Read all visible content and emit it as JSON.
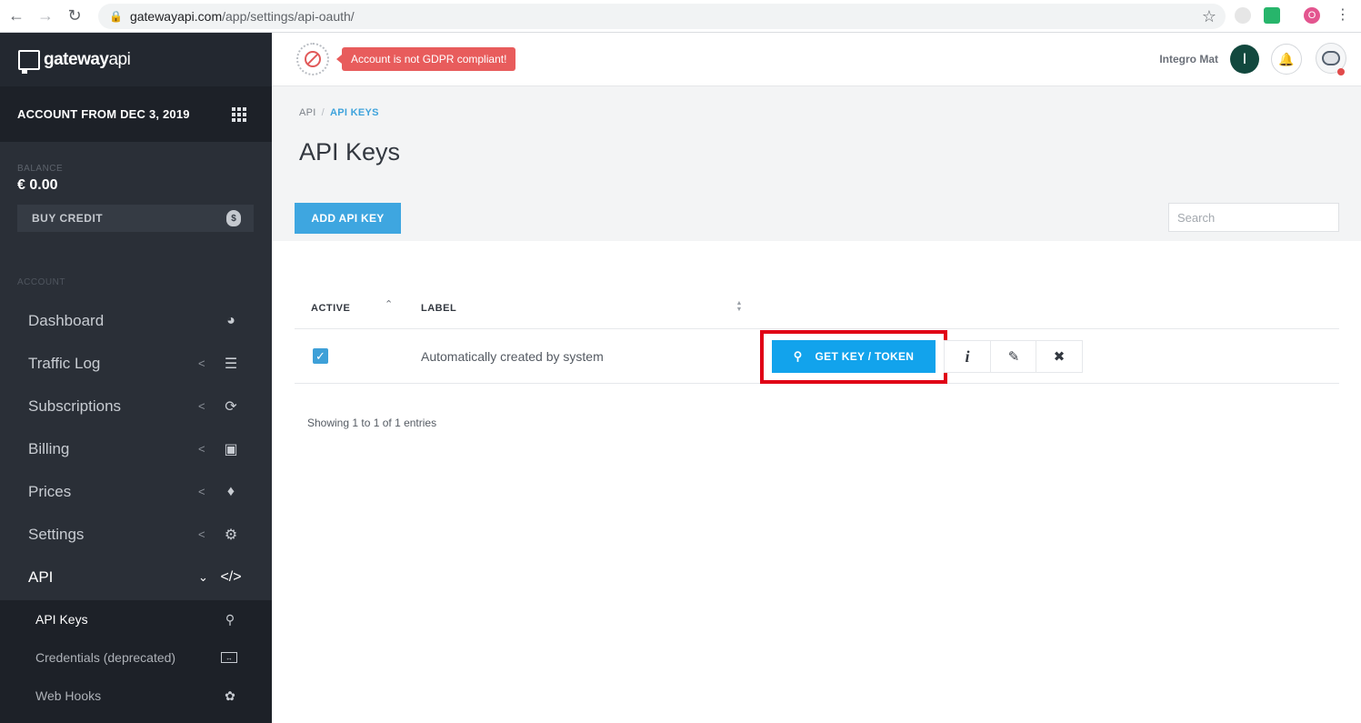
{
  "browser": {
    "url_host": "gatewayapi.com",
    "url_path": "/app/settings/api-oauth/",
    "ext_badge": "O"
  },
  "sidebar": {
    "logo_bold": "gateway",
    "logo_light": "api",
    "account_title": "ACCOUNT FROM DEC 3, 2019",
    "balance_label": "BALANCE",
    "balance_value": "€ 0.00",
    "buy_credit_label": "BUY CREDIT",
    "section_label": "ACCOUNT",
    "items": [
      {
        "label": "Dashboard",
        "icon": "dashboard-icon"
      },
      {
        "label": "Traffic Log",
        "icon": "database-icon"
      },
      {
        "label": "Subscriptions",
        "icon": "refresh-icon"
      },
      {
        "label": "Billing",
        "icon": "wallet-icon"
      },
      {
        "label": "Prices",
        "icon": "tag-icon"
      },
      {
        "label": "Settings",
        "icon": "gear-icon"
      },
      {
        "label": "API",
        "icon": "code-icon"
      }
    ],
    "sub_items": [
      {
        "label": "API Keys",
        "icon": "key-icon"
      },
      {
        "label": "Credentials (deprecated)",
        "icon": "credentials-icon"
      },
      {
        "label": "Web Hooks",
        "icon": "webhook-icon"
      }
    ]
  },
  "header": {
    "gdpr_badge": "Account is not GDPR compliant!",
    "username": "Integro Mat",
    "avatar_letter": "I"
  },
  "main": {
    "breadcrumb_root": "API",
    "breadcrumb_current": "API KEYS",
    "page_title": "API Keys",
    "add_button": "ADD API KEY",
    "search_placeholder": "Search",
    "table": {
      "columns": [
        "ACTIVE",
        "LABEL"
      ],
      "rows": [
        {
          "active": true,
          "label": "Automatically created by system",
          "action": "GET KEY / TOKEN"
        }
      ]
    },
    "showing_text": "Showing 1 to 1 of 1 entries"
  },
  "colors": {
    "sidebar_bg": "#2a2f37",
    "accent_blue": "#3ea6e0",
    "get_key_blue": "#12a3ec",
    "highlight_red": "#e00016",
    "gdpr_red": "#e85c5c"
  }
}
